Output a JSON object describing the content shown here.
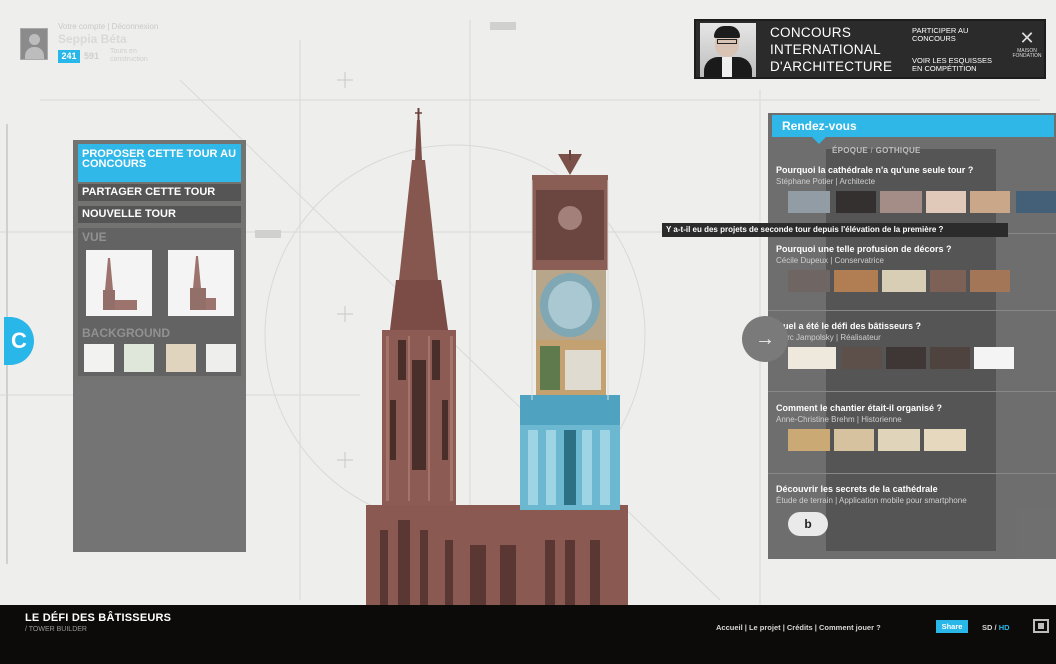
{
  "user": {
    "links": "Votre compte | Déconnexion",
    "name": "Seppia Béta",
    "score": "241",
    "score2": "591",
    "rank": "Tours en construction"
  },
  "banner": {
    "title_line1": "CONCOURS",
    "title_line2": "INTERNATIONAL",
    "title_line3": "D'ARCHITECTURE",
    "cta1": "PARTICIPER AU CONCOURS",
    "cta2": "VOIR LES ESQUISSES EN COMPÉTITION",
    "logo_text": "MAISON FONDATION"
  },
  "left_panel": {
    "propose": "PROPOSER CETTE TOUR AU CONCOURS",
    "share": "PARTAGER CETTE TOUR",
    "new_tower": "NOUVELLE TOUR",
    "vue_label": "VUE",
    "background_label": "BACKGROUND"
  },
  "right_panel": {
    "title": "Rendez-vous",
    "epoque": "ÉPOQUE",
    "gothique": "GOTHIQUE",
    "topics": [
      {
        "q": "Pourquoi la cathédrale n'a qu'une seule tour ?",
        "a": "Stéphane Potier | Architecte"
      },
      {
        "q": "Pourquoi une telle profusion de décors ?",
        "a": "Cécile Dupeux | Conservatrice"
      },
      {
        "q": "Quel a été le défi des bâtisseurs ?",
        "a": "Marc Jampolsky | Réalisateur"
      },
      {
        "q": "Comment le chantier était-il organisé ?",
        "a": "Anne-Christine Brehm | Historienne"
      },
      {
        "q": "Découvrir les secrets de la cathédrale",
        "a": "Étude de terrain | Application mobile pour smartphone"
      }
    ],
    "tooltip": "Y a-t-il eu des projets de seconde tour depuis l'élévation de la première ?",
    "arrow": "→",
    "play": "b"
  },
  "sidetab": "C",
  "footer": {
    "title": "LE DÉFI DES BÂTISSEURS",
    "subtitle": "/ TOWER BUILDER",
    "nav": "Accueil  |  Le projet  |  Crédits  |  Comment jouer ?",
    "share": "Share",
    "sd": "SD",
    "slash": " / ",
    "hd": "HD"
  },
  "colors": {
    "accent": "#29b6e8",
    "panel": "#6e6e6e",
    "footer": "#0d0b0a",
    "stone": "#8a5a52"
  }
}
